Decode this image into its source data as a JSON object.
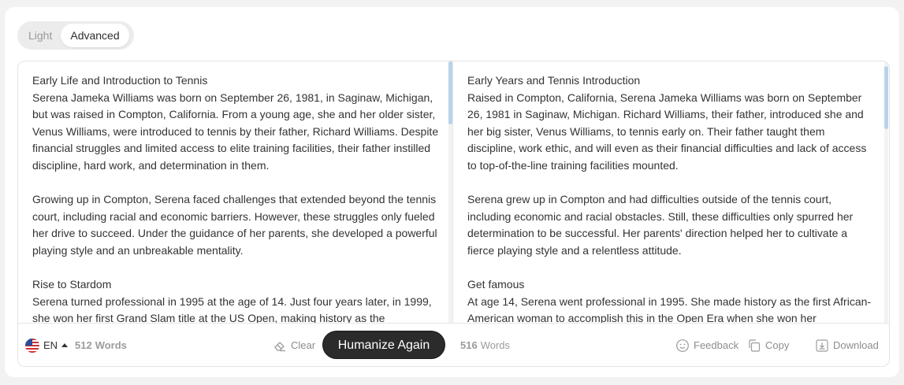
{
  "mode_toggle": {
    "options": [
      {
        "label": "Light",
        "active": false
      },
      {
        "label": "Advanced",
        "active": true
      }
    ]
  },
  "input_pane": {
    "paragraphs": [
      {
        "title": "Early Life and Introduction to Tennis",
        "text": "Serena Jameka Williams was born on September 26, 1981, in Saginaw, Michigan, but was raised in Compton, California. From a young age, she and her older sister, Venus Williams, were introduced to tennis by their father, Richard Williams. Despite financial struggles and limited access to elite training facilities, their father instilled discipline, hard work, and determination in them."
      },
      {
        "title": "",
        "text": "Growing up in Compton, Serena faced challenges that extended beyond the tennis court, including racial and economic barriers. However, these struggles only fueled her drive to succeed. Under the guidance of her parents, she developed a powerful playing style and an unbreakable mentality."
      },
      {
        "title": "Rise to Stardom",
        "text": "Serena turned professional in 1995 at the age of 14. Just four years later, in 1999, she won her first Grand Slam title at the US Open, making history as the"
      }
    ],
    "language": "EN",
    "word_count": "512",
    "word_label": "Words",
    "clear_label": "Clear",
    "humanize_label": "Humanize Again"
  },
  "output_pane": {
    "paragraphs": [
      {
        "title": "Early Years and Tennis Introduction",
        "text": "Raised in Compton, California, Serena Jameka Williams was born on September 26, 1981 in Saginaw, Michigan. Richard Williams, their father, introduced she and her big sister, Venus Williams, to tennis early on. Their father taught them discipline, work ethic, and will even as their financial difficulties and lack of access to top-of-the-line training facilities mounted."
      },
      {
        "title": "",
        "text": "Serena grew up in Compton and had difficulties outside of the tennis court, including economic and racial obstacles. Still, these difficulties only spurred her determination to be successful. Her parents' direction helped her to cultivate a fierce playing style and a relentless attitude."
      },
      {
        "title": "Get famous",
        "text": "At age 14, Serena went professional in 1995. She made history as the first African-American woman to accomplish this in the Open Era when she won her"
      }
    ],
    "word_count": "516",
    "word_label": "Words",
    "feedback_label": "Feedback",
    "copy_label": "Copy",
    "download_label": "Download"
  },
  "colors": {
    "button_bg": "#2b2b2b",
    "scroll_thumb": "#b9d3ea",
    "muted_text": "#9b9b9b"
  }
}
